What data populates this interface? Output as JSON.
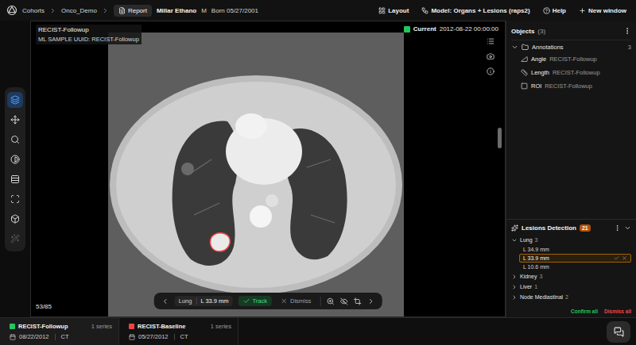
{
  "breadcrumb": [
    {
      "label": "Cohorts"
    },
    {
      "label": "Onco_Demo"
    }
  ],
  "report_button": "Report",
  "patient": {
    "name": "Millar Ethano",
    "sex": "M",
    "born": "Born 05/27/2001"
  },
  "top_actions": [
    {
      "label": "Layout"
    },
    {
      "label": "Model: Organs + Lesions (raps2)"
    },
    {
      "label": "Help"
    },
    {
      "label": "New window"
    }
  ],
  "tools": [
    {
      "selected": true,
      "disabled": false
    },
    {
      "selected": false,
      "disabled": false
    },
    {
      "selected": false,
      "disabled": false
    },
    {
      "selected": false,
      "disabled": false
    },
    {
      "selected": false,
      "disabled": false
    },
    {
      "selected": false,
      "disabled": false
    },
    {
      "selected": false,
      "disabled": false
    },
    {
      "selected": false,
      "disabled": true
    }
  ],
  "viewport": {
    "title": "RECIST-Followup",
    "subtitle": "ML SAMPLE UUID: RECIST-Followup",
    "status": "Current",
    "timestamp": "2012-08-22 00:00:00",
    "slice": "53/85"
  },
  "lesion_bar": {
    "organ": "Lung",
    "measure": "L 33.9 mm",
    "track": "Track",
    "dismiss": "Dismiss"
  },
  "objects": {
    "title": "Objects",
    "count": "(3)",
    "folder": {
      "label": "Annotations",
      "count": "3",
      "expanded": true
    },
    "items": [
      {
        "type": "Angle",
        "name": "RECIST-Followup"
      },
      {
        "type": "Length",
        "name": "RECIST-Followup"
      },
      {
        "type": "ROI",
        "name": "RECIST-Followup"
      }
    ]
  },
  "lesions": {
    "title": "Lesions Detection",
    "count": "21",
    "groups": [
      {
        "label": "Lung",
        "count": "3",
        "expanded": true,
        "items": [
          {
            "label": "L 34.9 mm",
            "selected": false
          },
          {
            "label": "L 33.9 mm",
            "selected": true
          },
          {
            "label": "L 10.6 mm",
            "selected": false
          }
        ]
      },
      {
        "label": "Kidney",
        "count": "3",
        "expanded": false,
        "items": []
      },
      {
        "label": "Liver",
        "count": "1",
        "expanded": false,
        "items": []
      },
      {
        "label": "Node Mediastinal",
        "count": "2",
        "expanded": false,
        "items": []
      }
    ],
    "confirm_all": "Confirm all",
    "dismiss_all": "Dismiss all"
  },
  "series": [
    {
      "title": "RECIST-Followup",
      "count": "1 series",
      "date": "08/22/2012",
      "modality": "CT",
      "color": "#22c55e",
      "selected": true
    },
    {
      "title": "RECIST-Baseline",
      "count": "1 series",
      "date": "05/27/2012",
      "modality": "CT",
      "color": "#ef4444",
      "selected": false
    }
  ]
}
